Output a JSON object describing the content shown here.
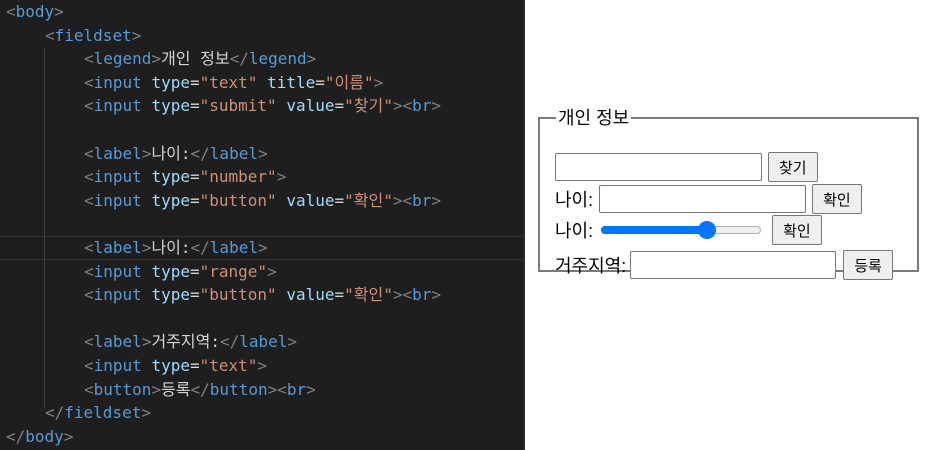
{
  "editor": {
    "lines": [
      [
        {
          "c": "t-bracket",
          "t": "<"
        },
        {
          "c": "t-tag",
          "t": "body"
        },
        {
          "c": "t-bracket",
          "t": ">"
        }
      ],
      [
        {
          "c": "t-bracket",
          "t": "<"
        },
        {
          "c": "t-tag",
          "t": "fieldset"
        },
        {
          "c": "t-bracket",
          "t": ">"
        }
      ],
      [
        {
          "c": "t-bracket",
          "t": "<"
        },
        {
          "c": "t-tag",
          "t": "legend"
        },
        {
          "c": "t-bracket",
          "t": ">"
        },
        {
          "c": "t-text",
          "t": "개인 정보"
        },
        {
          "c": "t-bracket",
          "t": "</"
        },
        {
          "c": "t-tag",
          "t": "legend"
        },
        {
          "c": "t-bracket",
          "t": ">"
        }
      ],
      [
        {
          "c": "t-bracket",
          "t": "<"
        },
        {
          "c": "t-tag",
          "t": "input"
        },
        {
          "c": "t-text",
          "t": " "
        },
        {
          "c": "t-attr",
          "t": "type"
        },
        {
          "c": "t-text",
          "t": "="
        },
        {
          "c": "t-str",
          "t": "\"text\""
        },
        {
          "c": "t-text",
          "t": " "
        },
        {
          "c": "t-attr",
          "t": "title"
        },
        {
          "c": "t-text",
          "t": "="
        },
        {
          "c": "t-str",
          "t": "\"이름\""
        },
        {
          "c": "t-bracket",
          "t": ">"
        }
      ],
      [
        {
          "c": "t-bracket",
          "t": "<"
        },
        {
          "c": "t-tag",
          "t": "input"
        },
        {
          "c": "t-text",
          "t": " "
        },
        {
          "c": "t-attr",
          "t": "type"
        },
        {
          "c": "t-text",
          "t": "="
        },
        {
          "c": "t-str",
          "t": "\"submit\""
        },
        {
          "c": "t-text",
          "t": " "
        },
        {
          "c": "t-attr",
          "t": "value"
        },
        {
          "c": "t-text",
          "t": "="
        },
        {
          "c": "t-str",
          "t": "\"찾기\""
        },
        {
          "c": "t-bracket",
          "t": "><"
        },
        {
          "c": "t-tag",
          "t": "br"
        },
        {
          "c": "t-bracket",
          "t": ">"
        }
      ],
      [],
      [
        {
          "c": "t-bracket",
          "t": "<"
        },
        {
          "c": "t-tag",
          "t": "label"
        },
        {
          "c": "t-bracket",
          "t": ">"
        },
        {
          "c": "t-text",
          "t": "나이:"
        },
        {
          "c": "t-bracket",
          "t": "</"
        },
        {
          "c": "t-tag",
          "t": "label"
        },
        {
          "c": "t-bracket",
          "t": ">"
        }
      ],
      [
        {
          "c": "t-bracket",
          "t": "<"
        },
        {
          "c": "t-tag",
          "t": "input"
        },
        {
          "c": "t-text",
          "t": " "
        },
        {
          "c": "t-attr",
          "t": "type"
        },
        {
          "c": "t-text",
          "t": "="
        },
        {
          "c": "t-str",
          "t": "\"number\""
        },
        {
          "c": "t-bracket",
          "t": ">"
        }
      ],
      [
        {
          "c": "t-bracket",
          "t": "<"
        },
        {
          "c": "t-tag",
          "t": "input"
        },
        {
          "c": "t-text",
          "t": " "
        },
        {
          "c": "t-attr",
          "t": "type"
        },
        {
          "c": "t-text",
          "t": "="
        },
        {
          "c": "t-str",
          "t": "\"button\""
        },
        {
          "c": "t-text",
          "t": " "
        },
        {
          "c": "t-attr",
          "t": "value"
        },
        {
          "c": "t-text",
          "t": "="
        },
        {
          "c": "t-str",
          "t": "\"확인\""
        },
        {
          "c": "t-bracket",
          "t": "><"
        },
        {
          "c": "t-tag",
          "t": "br"
        },
        {
          "c": "t-bracket",
          "t": ">"
        }
      ],
      [],
      [
        {
          "c": "t-bracket",
          "t": "<"
        },
        {
          "c": "t-tag",
          "t": "label"
        },
        {
          "c": "t-bracket",
          "t": ">"
        },
        {
          "c": "t-text",
          "t": "나이:"
        },
        {
          "c": "t-bracket",
          "t": "</"
        },
        {
          "c": "t-tag",
          "t": "label"
        },
        {
          "c": "t-bracket",
          "t": ">"
        }
      ],
      [
        {
          "c": "t-bracket",
          "t": "<"
        },
        {
          "c": "t-tag",
          "t": "input"
        },
        {
          "c": "t-text",
          "t": " "
        },
        {
          "c": "t-attr",
          "t": "type"
        },
        {
          "c": "t-text",
          "t": "="
        },
        {
          "c": "t-str",
          "t": "\"range\""
        },
        {
          "c": "t-bracket",
          "t": ">"
        }
      ],
      [
        {
          "c": "t-bracket",
          "t": "<"
        },
        {
          "c": "t-tag",
          "t": "input"
        },
        {
          "c": "t-text",
          "t": " "
        },
        {
          "c": "t-attr",
          "t": "type"
        },
        {
          "c": "t-text",
          "t": "="
        },
        {
          "c": "t-str",
          "t": "\"button\""
        },
        {
          "c": "t-text",
          "t": " "
        },
        {
          "c": "t-attr",
          "t": "value"
        },
        {
          "c": "t-text",
          "t": "="
        },
        {
          "c": "t-str",
          "t": "\"확인\""
        },
        {
          "c": "t-bracket",
          "t": "><"
        },
        {
          "c": "t-tag",
          "t": "br"
        },
        {
          "c": "t-bracket",
          "t": ">"
        }
      ],
      [],
      [
        {
          "c": "t-bracket",
          "t": "<"
        },
        {
          "c": "t-tag",
          "t": "label"
        },
        {
          "c": "t-bracket",
          "t": ">"
        },
        {
          "c": "t-text",
          "t": "거주지역:"
        },
        {
          "c": "t-bracket",
          "t": "</"
        },
        {
          "c": "t-tag",
          "t": "label"
        },
        {
          "c": "t-bracket",
          "t": ">"
        }
      ],
      [
        {
          "c": "t-bracket",
          "t": "<"
        },
        {
          "c": "t-tag",
          "t": "input"
        },
        {
          "c": "t-text",
          "t": " "
        },
        {
          "c": "t-attr",
          "t": "type"
        },
        {
          "c": "t-text",
          "t": "="
        },
        {
          "c": "t-str",
          "t": "\"text\""
        },
        {
          "c": "t-bracket",
          "t": ">"
        }
      ],
      [
        {
          "c": "t-bracket",
          "t": "<"
        },
        {
          "c": "t-tag",
          "t": "button"
        },
        {
          "c": "t-bracket",
          "t": ">"
        },
        {
          "c": "t-text",
          "t": "등록"
        },
        {
          "c": "t-bracket",
          "t": "</"
        },
        {
          "c": "t-tag",
          "t": "button"
        },
        {
          "c": "t-bracket",
          "t": "><"
        },
        {
          "c": "t-tag",
          "t": "br"
        },
        {
          "c": "t-bracket",
          "t": ">"
        }
      ],
      [
        {
          "c": "t-bracket",
          "t": "</"
        },
        {
          "c": "t-tag",
          "t": "fieldset"
        },
        {
          "c": "t-bracket",
          "t": ">"
        }
      ],
      [
        {
          "c": "t-bracket",
          "t": "</"
        },
        {
          "c": "t-tag",
          "t": "body"
        },
        {
          "c": "t-bracket",
          "t": ">"
        }
      ]
    ],
    "colors": {
      "background": "#1e1e1e",
      "tag": "#569cd6",
      "bracket": "#808080",
      "attribute": "#9cdcfe",
      "string": "#ce9178",
      "text": "#d4d4d4"
    }
  },
  "preview": {
    "legend": "개인 정보",
    "search_input_value": "",
    "search_button": "찾기",
    "age_label_1": "나이:",
    "age_number_value": "",
    "confirm_button_1": "확인",
    "age_label_2": "나이:",
    "age_range_value": 0.68,
    "confirm_button_2": "확인",
    "region_label": "거주지역:",
    "region_input_value": "",
    "register_button": "등록",
    "accent_color": "#0075ff"
  }
}
